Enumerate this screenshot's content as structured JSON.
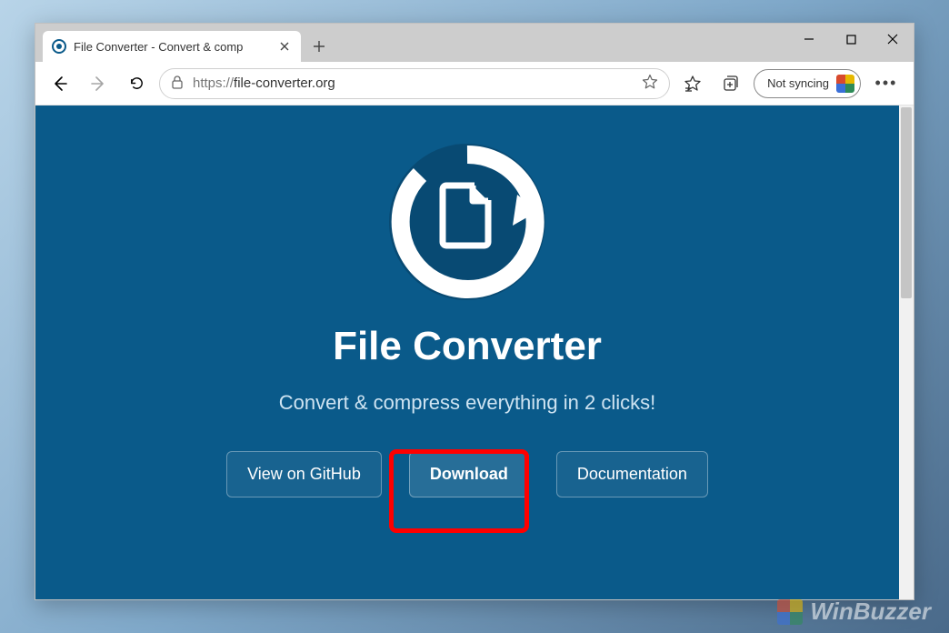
{
  "browser": {
    "tab_title": "File Converter - Convert & comp",
    "url_scheme": "https://",
    "url_host": "file-converter.org",
    "profile_label": "Not syncing"
  },
  "page": {
    "title": "File Converter",
    "subtitle": "Convert & compress everything in 2 clicks!",
    "buttons": {
      "github": "View on GitHub",
      "download": "Download",
      "docs": "Documentation"
    }
  },
  "watermark": "WinBuzzer"
}
